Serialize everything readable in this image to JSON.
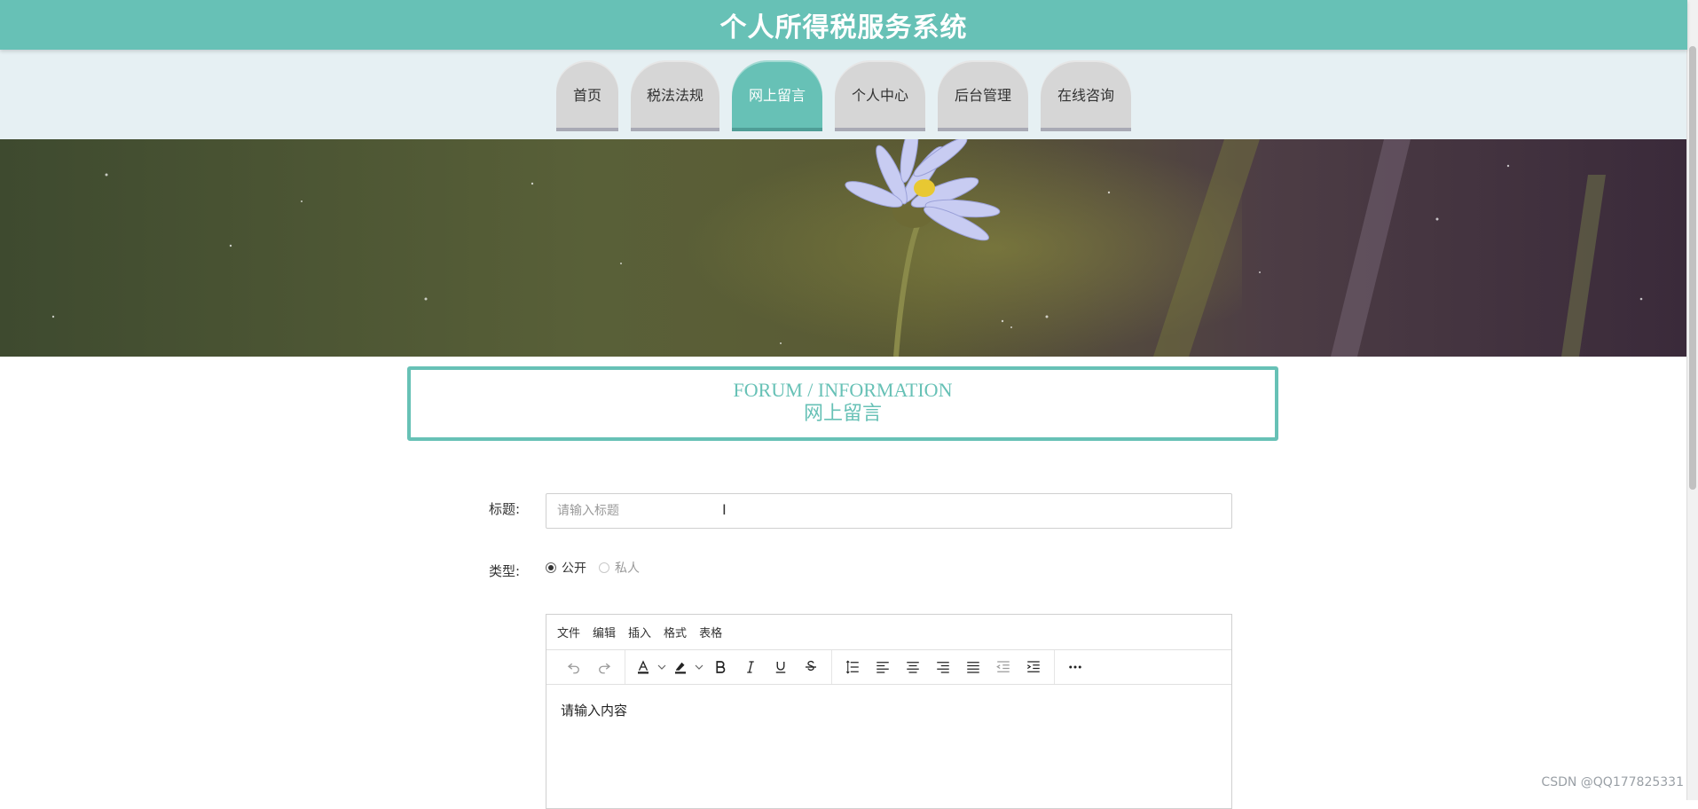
{
  "app": {
    "title": "个人所得税服务系统"
  },
  "nav": {
    "items": [
      {
        "label": "首页",
        "active": false
      },
      {
        "label": "税法法规",
        "active": false
      },
      {
        "label": "网上留言",
        "active": true
      },
      {
        "label": "个人中心",
        "active": false
      },
      {
        "label": "后台管理",
        "active": false
      },
      {
        "label": "在线咨询",
        "active": false
      }
    ]
  },
  "section": {
    "title_en": "FORUM / INFORMATION",
    "title_cn": "网上留言"
  },
  "form": {
    "title_label": "标题:",
    "title_placeholder": "请输入标题",
    "type_label": "类型:",
    "type_options": [
      {
        "label": "公开",
        "checked": true
      },
      {
        "label": "私人",
        "checked": false
      }
    ]
  },
  "editor": {
    "menu": [
      "文件",
      "编辑",
      "插入",
      "格式",
      "表格"
    ],
    "placeholder": "请输入内容",
    "toolbar_icons": [
      "undo-icon",
      "redo-icon",
      "text-color-icon",
      "highlight-icon",
      "bold-icon",
      "italic-icon",
      "underline-icon",
      "strikethrough-icon",
      "line-height-icon",
      "align-left-icon",
      "align-center-icon",
      "align-right-icon",
      "align-justify-icon",
      "outdent-icon",
      "indent-icon",
      "more-icon"
    ]
  },
  "watermark": "CSDN @QQ177825331",
  "colors": {
    "primary": "#67c1b6",
    "nav_inactive": "#d6d6d6",
    "nav_bg": "#e6f0f3"
  }
}
